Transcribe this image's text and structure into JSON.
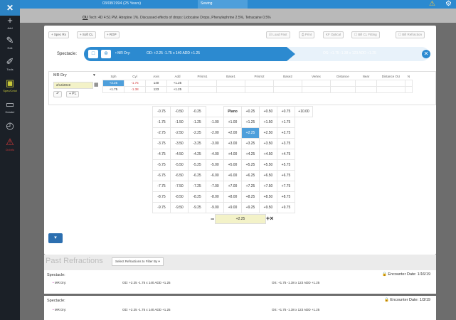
{
  "sidebar": {
    "items": [
      {
        "icon": "plus-icon",
        "glyph": "+",
        "label": "Add"
      },
      {
        "icon": "edit-icon",
        "glyph": "✎",
        "label": "Edit"
      },
      {
        "icon": "brush-icon",
        "glyph": "✐",
        "label": "Tools"
      },
      {
        "icon": "specs-icon",
        "glyph": "▣",
        "label": "Spec/Cntct"
      },
      {
        "icon": "monitor-icon",
        "glyph": "▭",
        "label": "Header"
      },
      {
        "icon": "history-icon",
        "glyph": "◴",
        "label": ""
      },
      {
        "icon": "alert-icon",
        "glyph": "⚠",
        "label": "Dr.Info"
      }
    ]
  },
  "topbar": {
    "dob": "03/08/1994 (25 Years)",
    "tab": "Sewing",
    "history_line_label": "OU",
    "history_line": "Tech: 4D 4:51 PM. Atropine 1%. Discussed effects of drops: Lidocaine Drops, Phenylephrine 2.5%, Tetracaine 0.5%"
  },
  "buttons": {
    "spec_rx": "+ Spec Rx",
    "soft_cl": "+ Soft CL",
    "rgp": "+ RGP",
    "load_past": "Load Past",
    "print": "Print",
    "kf_optical": "KF Optical",
    "bill_cl_fitting": "Bill CL Fitting",
    "bill_refraction": "Bill Refraction"
  },
  "spectacle": {
    "label": "Spectacle:",
    "mr_dry": "• MR Dry:",
    "od": "OD: +2.25 -1.75 x 140 ADD +1.25",
    "os": "OS: +1.75 -1.38 x 123 ADD +1.25"
  },
  "rx_editor": {
    "type": "MR Dry",
    "date": "2/14/2019",
    "pl_button": "+ PL",
    "columns": [
      "Sph",
      "Cyl",
      "Axis",
      "Add",
      "Prism1",
      "Base1",
      "Prism2",
      "Base2",
      "Vertex",
      "Distance",
      "Near",
      "Distance OU",
      "N"
    ],
    "rows": [
      [
        "+2.25",
        "-1.75",
        "140",
        "+1.25",
        "",
        "",
        "",
        "",
        "",
        "",
        "",
        "",
        ""
      ],
      [
        "+1.75",
        "-1.38",
        "123",
        "+1.25",
        "",
        "",
        "",
        "",
        "",
        "",
        "",
        "",
        ""
      ]
    ]
  },
  "picker": {
    "rows": [
      [
        "-0.75",
        "-0.50",
        "-0.25",
        "",
        "Plano",
        "+0.25",
        "+0.50",
        "+0.75",
        "+10.00"
      ],
      [
        "-1.75",
        "-1.50",
        "-1.25",
        "-1.00",
        "+1.00",
        "+1.25",
        "+1.50",
        "+1.75",
        ""
      ],
      [
        "-2.75",
        "-2.50",
        "-2.25",
        "-2.00",
        "+2.00",
        "+2.25",
        "+2.50",
        "+2.75",
        ""
      ],
      [
        "-3.75",
        "-3.50",
        "-3.25",
        "-3.00",
        "+3.00",
        "+3.25",
        "+3.50",
        "+3.75",
        ""
      ],
      [
        "-4.75",
        "-4.50",
        "-4.25",
        "-4.00",
        "+4.00",
        "+4.25",
        "+4.50",
        "+4.75",
        ""
      ],
      [
        "-5.75",
        "-5.50",
        "-5.25",
        "-5.00",
        "+5.00",
        "+5.25",
        "+5.50",
        "+5.75",
        ""
      ],
      [
        "-6.75",
        "-6.50",
        "-6.25",
        "-6.00",
        "+6.00",
        "+6.25",
        "+6.50",
        "+6.75",
        ""
      ],
      [
        "-7.75",
        "-7.50",
        "-7.25",
        "-7.00",
        "+7.00",
        "+7.25",
        "+7.50",
        "+7.75",
        ""
      ],
      [
        "-8.75",
        "-8.50",
        "-8.25",
        "-8.00",
        "+8.00",
        "+8.25",
        "+8.50",
        "+8.75",
        ""
      ],
      [
        "-9.75",
        "-9.50",
        "-9.25",
        "-9.00",
        "+9.00",
        "+9.25",
        "+9.50",
        "+9.75",
        ""
      ]
    ],
    "selected": "+2.25",
    "current_value": "+2.25"
  },
  "past": {
    "title": "Past Refractions",
    "filter": "Select Refractions to Filter By ▾",
    "cards": [
      {
        "head": "Spectacle:",
        "encounter": "Encounter Date: 1/16/19",
        "row_label": "MR Dry:",
        "od": "OD: +2.25 -1.75 x 140 ADD +1.25",
        "os": "OS: +1.75 -1.38 x 123 ADD +1.25"
      },
      {
        "head": "Spectacle:",
        "encounter": "Encounter Date: 1/3/19",
        "row_label": "MR Dry:",
        "od": "OD: +2.25 -1.75 x 140 ADD +1.25",
        "os": "OS: +1.75 -1.38 x 123 ADD +1.25"
      }
    ]
  },
  "colors": {
    "accent": "#2c8ad0",
    "sidebar": "#1b2027",
    "highlight": "#4e9fdb",
    "input_yellow": "#f3f2c8"
  }
}
